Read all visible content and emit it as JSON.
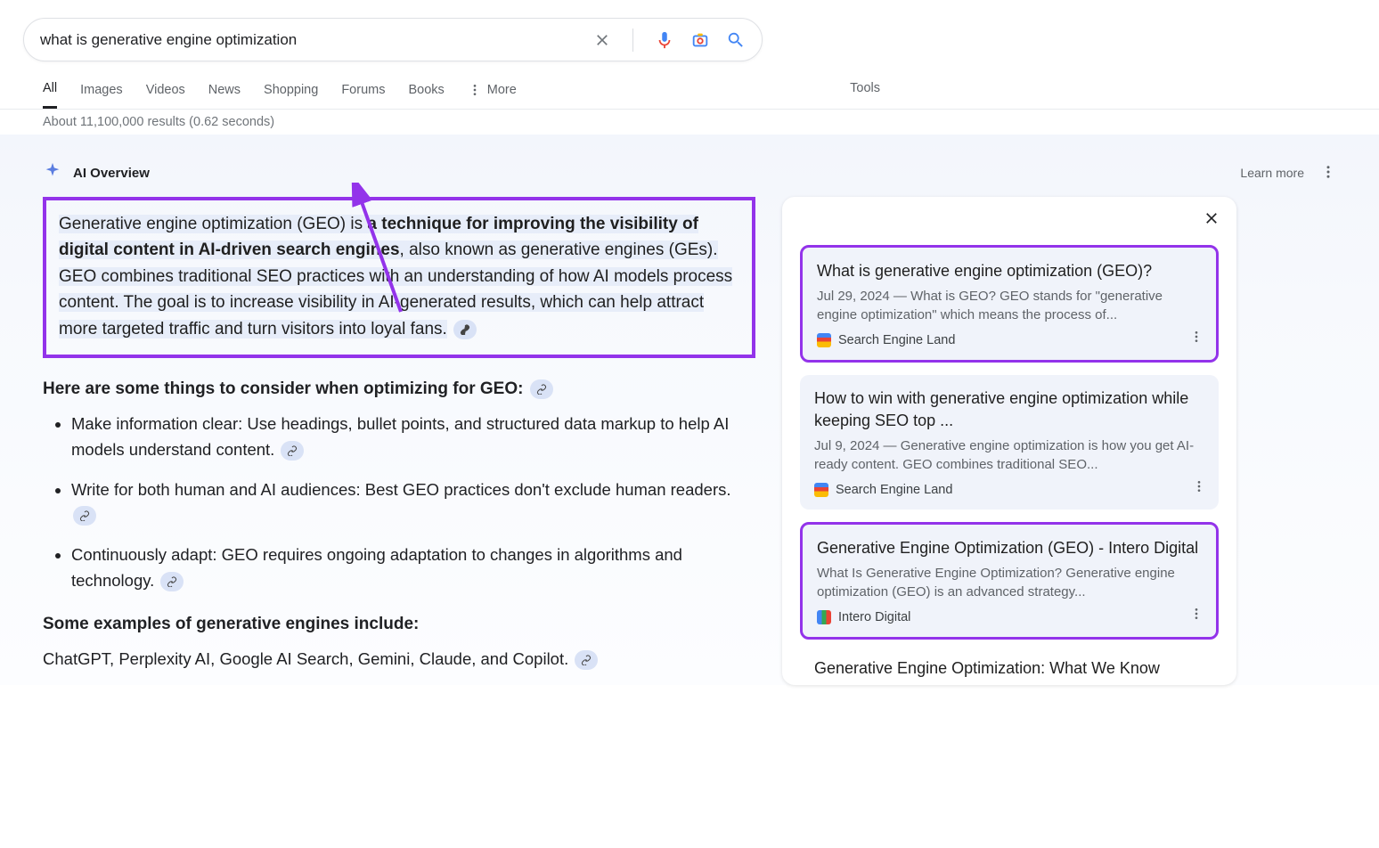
{
  "search": {
    "query": "what is generative engine optimization"
  },
  "tabs": {
    "all": "All",
    "images": "Images",
    "videos": "Videos",
    "news": "News",
    "shopping": "Shopping",
    "forums": "Forums",
    "books": "Books",
    "more": "More",
    "tools": "Tools"
  },
  "stats": "About 11,100,000 results (0.62 seconds)",
  "ai": {
    "title": "AI Overview",
    "learn_more": "Learn more",
    "summary_prefix": "Generative engine optimization (GEO) is ",
    "summary_bold": "a technique for improving the visibility of digital content in AI-driven search engines",
    "summary_rest": ", also known as generative engines (GEs). GEO combines traditional SEO practices with an understanding of how AI models process content. The goal is to increase visibility in AI-generated results, which can help attract more targeted traffic and turn visitors into loyal fans.",
    "heading_consider": "Here are some things to consider when optimizing for GEO:",
    "bullets": [
      "Make information clear: Use headings, bullet points, and structured data markup to help AI models understand content.",
      "Write for both human and AI audiences: Best GEO practices don't exclude human readers.",
      "Continuously adapt: GEO requires ongoing adaptation to changes in algorithms and technology."
    ],
    "heading_examples": "Some examples of generative engines include:",
    "examples_line": "ChatGPT, Perplexity AI, Google AI Search, Gemini, Claude, and Copilot."
  },
  "sidebar": {
    "cards": [
      {
        "title": "What is generative engine optimization (GEO)?",
        "snippet": "Jul 29, 2024 — What is GEO? GEO stands for \"generative engine optimization\" which means the process of...",
        "source": "Search Engine Land"
      },
      {
        "title": "How to win with generative engine optimization while keeping SEO top ...",
        "snippet": "Jul 9, 2024 — Generative engine optimization is how you get AI-ready content. GEO combines traditional SEO...",
        "source": "Search Engine Land"
      },
      {
        "title": "Generative Engine Optimization (GEO) - Intero Digital",
        "snippet": "What Is Generative Engine Optimization? Generative engine optimization (GEO) is an advanced strategy...",
        "source": "Intero Digital"
      }
    ],
    "truncated": "Generative Engine Optimization: What We Know"
  }
}
